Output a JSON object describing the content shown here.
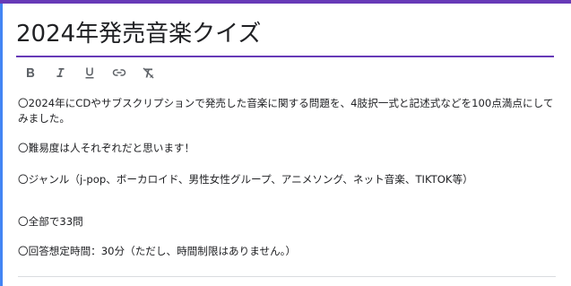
{
  "form": {
    "title": "2024年発売音楽クイズ",
    "toolbar": {
      "bold_icon": "bold-icon",
      "italic_icon": "italic-icon",
      "underline_icon": "underline-icon",
      "link_icon": "link-icon",
      "clear_format_icon": "clear-format-icon"
    },
    "description": [
      "〇2024年にCDやサブスクリプションで発売した音楽に関する問題を、4肢択一式と記述式などを100点満点にしてみました。",
      "〇難易度は人それぞれだと思います！",
      "〇ジャンル（j-pop、ボーカロイド、男性女性グループ、アニメソング、ネット音楽、TIKTOK等）",
      "〇全部で33問",
      "〇回答想定時間：30分（ただし、時間制限はありません。）"
    ]
  },
  "colors": {
    "accent": "#673ab7",
    "side_accent": "#4285f4"
  }
}
